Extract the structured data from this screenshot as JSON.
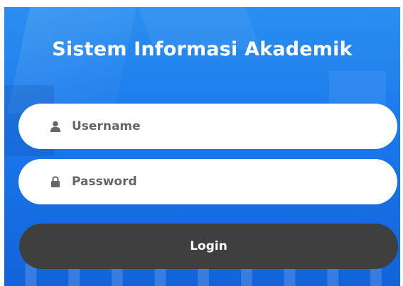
{
  "title": "Sistem Informasi Akademik",
  "username": {
    "placeholder": "Username",
    "value": "",
    "icon": "user-icon"
  },
  "password": {
    "placeholder": "Password",
    "value": "",
    "icon": "lock-icon"
  },
  "login_label": "Login",
  "colors": {
    "background_top": "#2b8ff0",
    "background_bottom": "#1263d9",
    "field_bg": "#ffffff",
    "button_bg": "#3f3f3f",
    "button_text": "#ffffff"
  }
}
